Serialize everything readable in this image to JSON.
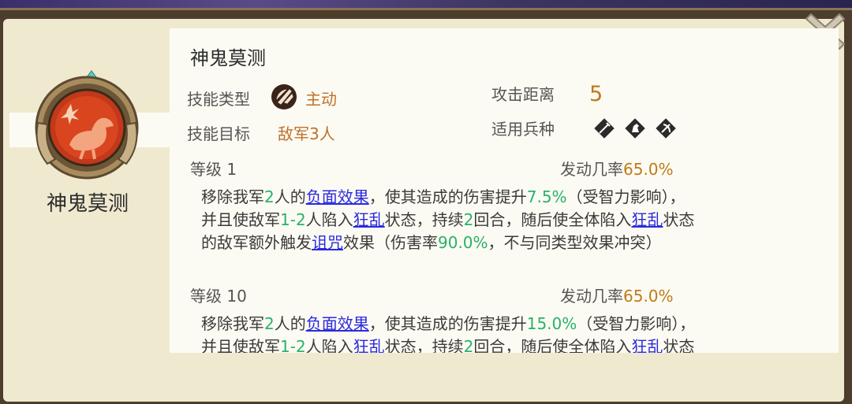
{
  "skill": {
    "name": "神鬼莫测",
    "panel_name": "神鬼莫测",
    "type_label": "技能类型",
    "type_value": "主动",
    "type_icon": "active-skill-icon",
    "target_label": "技能目标",
    "target_value": "敌军3人",
    "range_label": "攻击距离",
    "range_value": "5",
    "troop_label": "适用兵种",
    "troop_icons": [
      "infantry-icon",
      "cavalry-icon",
      "archer-icon"
    ],
    "icon": "red-bird-skill-icon"
  },
  "levels": [
    {
      "label": "等级",
      "level": "1",
      "rate_label": "发动几率",
      "rate": "65.0%",
      "desc": [
        {
          "t": "移除我军"
        },
        {
          "t": "2",
          "c": "g"
        },
        {
          "t": "人的"
        },
        {
          "t": "负面效果",
          "c": "u"
        },
        {
          "t": "，使其造成的伤害提升"
        },
        {
          "t": "7.5%",
          "c": "g"
        },
        {
          "t": "（受智力影响），\n并且使敌军"
        },
        {
          "t": "1-2",
          "c": "g"
        },
        {
          "t": "人陷入"
        },
        {
          "t": "狂乱",
          "c": "u"
        },
        {
          "t": "状态，持续"
        },
        {
          "t": "2",
          "c": "g"
        },
        {
          "t": "回合，随后使全体陷入"
        },
        {
          "t": "狂乱",
          "c": "u"
        },
        {
          "t": "状态\n的敌军额外触发"
        },
        {
          "t": "诅咒",
          "c": "u"
        },
        {
          "t": "效果（伤害率"
        },
        {
          "t": "90.0%",
          "c": "g"
        },
        {
          "t": "，不与同类型效果冲突）"
        }
      ]
    },
    {
      "label": "等级",
      "level": "10",
      "rate_label": "发动几率",
      "rate": "65.0%",
      "desc": [
        {
          "t": "移除我军"
        },
        {
          "t": "2",
          "c": "g"
        },
        {
          "t": "人的"
        },
        {
          "t": "负面效果",
          "c": "u"
        },
        {
          "t": "，使其造成的伤害提升"
        },
        {
          "t": "15.0%",
          "c": "g"
        },
        {
          "t": "（受智力影响），\n并且使敌军"
        },
        {
          "t": "1-2",
          "c": "g"
        },
        {
          "t": "人陷入"
        },
        {
          "t": "狂乱",
          "c": "u"
        },
        {
          "t": "状态，持续"
        },
        {
          "t": "2",
          "c": "g"
        },
        {
          "t": "回合，随后使全体陷入"
        },
        {
          "t": "狂乱",
          "c": "u"
        },
        {
          "t": "状态"
        }
      ]
    }
  ],
  "colors": {
    "panel_bg": "#efe9cf",
    "card_bg": "#fcfbf3",
    "orange": "#c0702a",
    "green_value": "#28b26a",
    "link_blue": "#2a2ae0"
  },
  "close_icon": "close-x-icon"
}
